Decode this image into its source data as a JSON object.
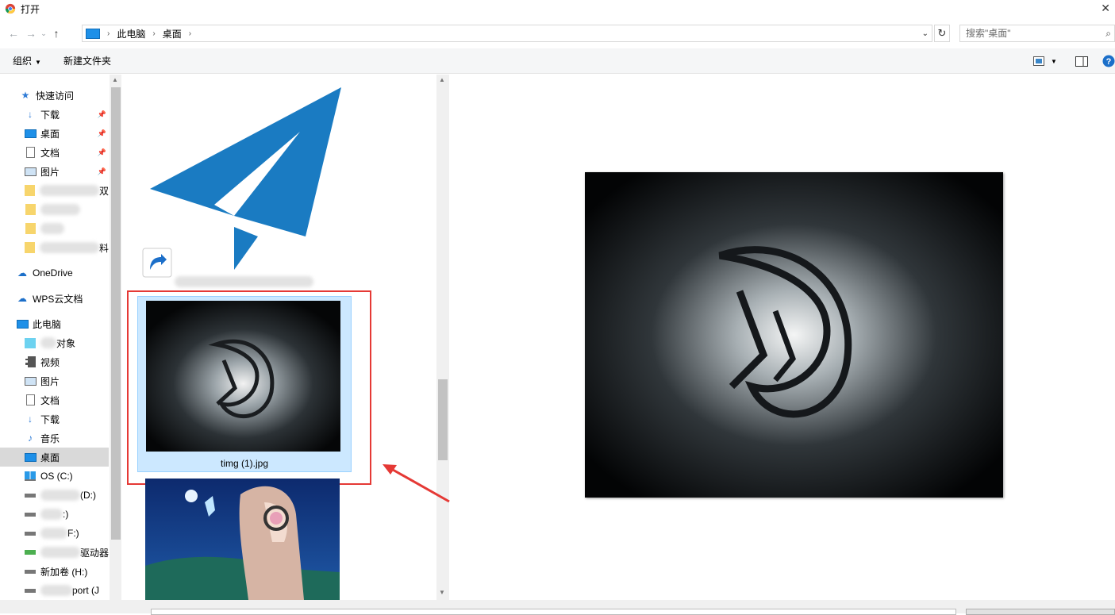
{
  "window": {
    "title": "打开"
  },
  "address": {
    "crumbs": [
      "此电脑",
      "桌面"
    ],
    "search_placeholder": "搜索\"桌面\""
  },
  "toolbar": {
    "organize": "组织",
    "new_folder": "新建文件夹"
  },
  "sidebar": {
    "quick_access": "快速访问",
    "pinned": [
      "下载",
      "桌面",
      "文档",
      "图片"
    ],
    "blurred_folder_suffixes": [
      "双",
      "",
      "",
      "料"
    ],
    "onedrive": "OneDrive",
    "wps": "WPS云文档",
    "this_pc": "此电脑",
    "pc_items": [
      "对象",
      "视频",
      "图片",
      "文档",
      "下载",
      "音乐",
      "桌面",
      "OS (C:)"
    ],
    "drives_partial": [
      "(D:)",
      ":)",
      "F:)",
      "驱动器",
      "新加卷 (H:)",
      "port (J"
    ]
  },
  "content": {
    "selected_file": "timg (1).jpg"
  },
  "colors": {
    "selection_bg": "#cce8ff",
    "highlight": "#e53935",
    "arrow": "#e53935",
    "logo_blue": "#1a7bc2"
  }
}
